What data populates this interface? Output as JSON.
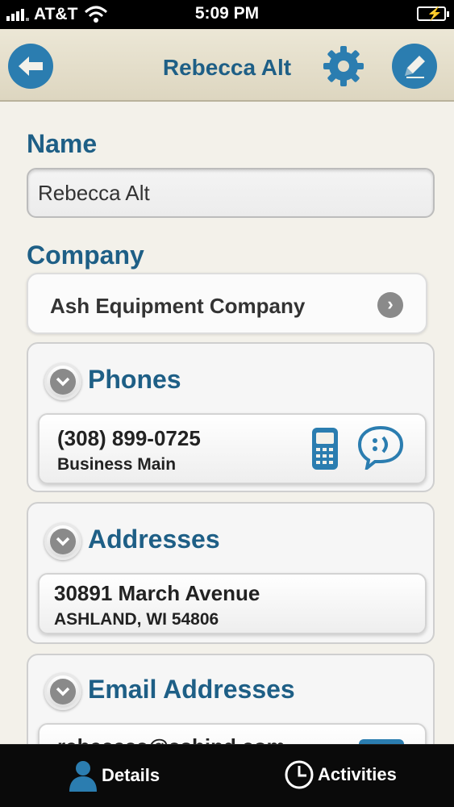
{
  "status_bar": {
    "carrier": "AT&T",
    "time": "5:09 PM"
  },
  "header": {
    "title": "Rebecca Alt"
  },
  "name_section": {
    "label": "Name",
    "value": "Rebecca Alt"
  },
  "company_section": {
    "label": "Company",
    "value": "Ash Equipment Company"
  },
  "phones": {
    "title": "Phones",
    "items": [
      {
        "number": "(308) 899-0725",
        "type": "Business Main"
      }
    ]
  },
  "addresses": {
    "title": "Addresses",
    "items": [
      {
        "street": "30891 March Avenue",
        "city_line": "ASHLAND, WI 54806"
      }
    ]
  },
  "emails": {
    "title": "Email Addresses",
    "items": [
      {
        "address": "rebeccaa@ashind.com"
      }
    ]
  },
  "tab_bar": {
    "tabs": [
      {
        "label": "Details",
        "icon": "person-icon"
      },
      {
        "label": "Activities",
        "icon": "clock-icon"
      }
    ]
  },
  "colors": {
    "accent": "#1e5f86",
    "button_blue": "#2b7db0",
    "nav_bg": "#e6e0cd",
    "page_bg": "#f3f1ea"
  }
}
